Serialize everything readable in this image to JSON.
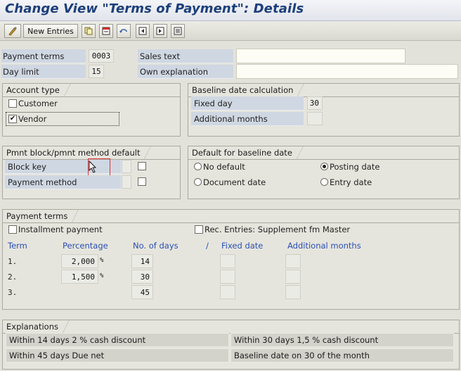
{
  "window": {
    "title": "Change View \"Terms of Payment\": Details"
  },
  "toolbar": {
    "buttons": [
      {
        "name": "edit-toggle-icon"
      },
      {
        "label": "New Entries"
      },
      {
        "name": "copy-icon"
      },
      {
        "name": "delete-icon"
      },
      {
        "name": "undo-icon"
      },
      {
        "name": "first-entry-icon"
      },
      {
        "name": "previous-entry-icon"
      },
      {
        "name": "next-entry-icon"
      }
    ]
  },
  "header": {
    "payment_terms_label": "Payment terms",
    "payment_terms_value": "0003",
    "day_limit_label": "Day limit",
    "day_limit_value": "15",
    "sales_text_label": "Sales text",
    "sales_text_value": "",
    "own_explanation_label": "Own explanation",
    "own_explanation_value": ""
  },
  "account_type": {
    "title": "Account type",
    "customer_label": "Customer",
    "customer_checked": false,
    "vendor_label": "Vendor",
    "vendor_checked": true
  },
  "baseline_calc": {
    "title": "Baseline date calculation",
    "fixed_day_label": "Fixed day",
    "fixed_day_value": "30",
    "additional_months_label": "Additional months",
    "additional_months_value": ""
  },
  "pmnt_block": {
    "title": "Pmnt block/pmnt method default",
    "block_key_label": "Block key",
    "payment_method_label": "Payment method"
  },
  "default_baseline": {
    "title": "Default for baseline date",
    "no_default": "No default",
    "document_date": "Document date",
    "posting_date": "Posting date",
    "entry_date": "Entry date",
    "selected": "Posting date"
  },
  "payment_terms": {
    "title": "Payment terms",
    "installment_label": "Installment payment",
    "rec_entries_label": "Rec. Entries: Supplement fm Master",
    "columns": {
      "term": "Term",
      "percentage": "Percentage",
      "no_of_days": "No. of days",
      "separator": "/",
      "fixed_date": "Fixed date",
      "additional_months": "Additional months"
    },
    "percent_unit": "%",
    "rows": [
      {
        "term": "1.",
        "percentage": "2,000",
        "days": "14",
        "fixed_date": "",
        "additional_months": ""
      },
      {
        "term": "2.",
        "percentage": "1,500",
        "days": "30",
        "fixed_date": "",
        "additional_months": ""
      },
      {
        "term": "3.",
        "percentage": "",
        "days": "45",
        "fixed_date": "",
        "additional_months": ""
      }
    ]
  },
  "explanations": {
    "title": "Explanations",
    "lines": [
      "Within 14 days 2 % cash discount",
      "Within 30 days 1,5 % cash discount",
      "Within 45 days Due net",
      "Baseline date on 30 of the month"
    ]
  }
}
